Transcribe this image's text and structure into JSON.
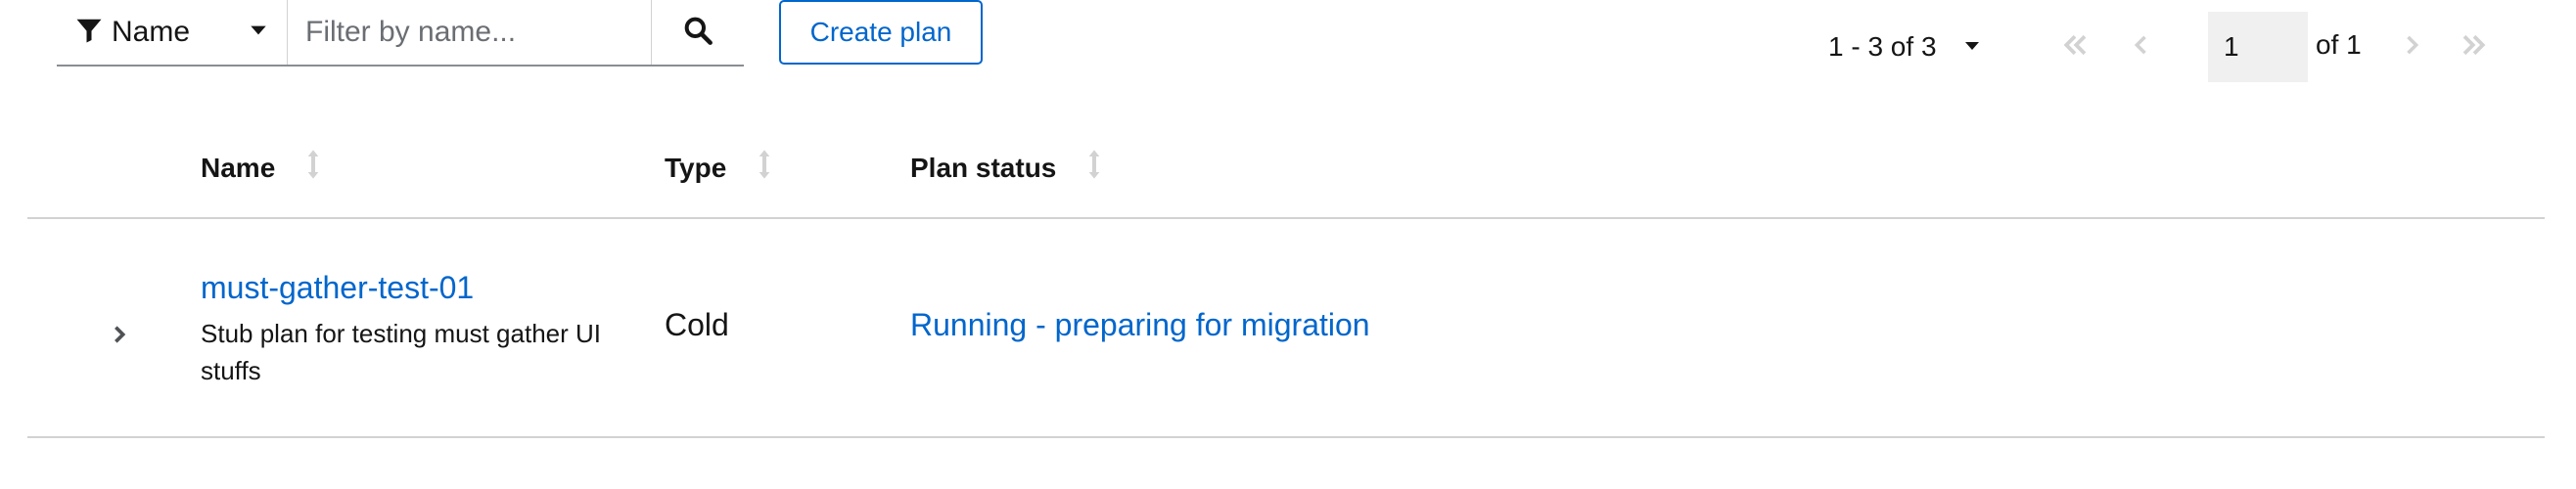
{
  "toolbar": {
    "filter_attribute": "Name",
    "filter_placeholder": "Filter by name...",
    "filter_value": "",
    "create_label": "Create plan"
  },
  "pagination": {
    "range_label": "1 - 3 of 3",
    "current_page": "1",
    "total_label": "of 1"
  },
  "table": {
    "columns": [
      {
        "label": "Name"
      },
      {
        "label": "Type"
      },
      {
        "label": "Plan status"
      }
    ],
    "rows": [
      {
        "name": "must-gather-test-01",
        "description": "Stub plan for testing must gather UI stuffs",
        "type": "Cold",
        "status": "Running - preparing for migration"
      }
    ]
  },
  "colors": {
    "link": "#0066cc",
    "border": "#d2d2d2",
    "muted_icon": "#d2d2d2",
    "text": "#151515"
  },
  "icons": [
    "filter-icon",
    "caret-down-icon",
    "search-icon",
    "angle-double-left-icon",
    "angle-left-icon",
    "angle-right-icon",
    "angle-double-right-icon",
    "sort-icon",
    "angle-right-icon"
  ]
}
